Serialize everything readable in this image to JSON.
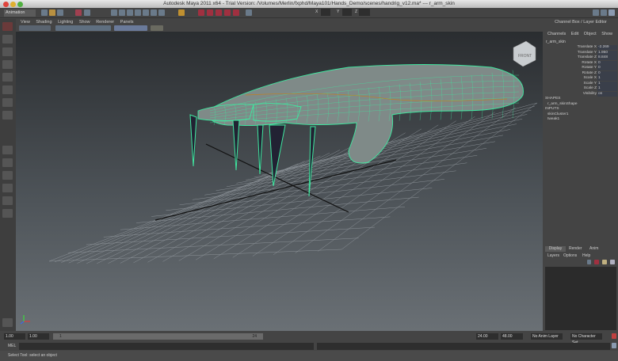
{
  "window": {
    "title": "Autodesk Maya 2011 x64 - Trial Version: /Volumes/Merlin/fxphd/Maya101/Hands_Demo/scenes/handrig_v12.ma*  ---  r_arm_skin"
  },
  "statusline": {
    "mode": "Animation",
    "coord_labels": [
      "X",
      "Y",
      "Z"
    ]
  },
  "viewport": {
    "menu": [
      "View",
      "Shading",
      "Lighting",
      "Show",
      "Renderer",
      "Panels"
    ],
    "viewcube": "FRONT"
  },
  "channel_box": {
    "title": "Channel Box / Layer Editor",
    "menu": [
      "Channels",
      "Edit",
      "Object",
      "Show"
    ],
    "object": "r_arm_skin",
    "attributes": [
      {
        "name": "Translate X",
        "value": "-2.269"
      },
      {
        "name": "Translate Y",
        "value": "1.950"
      },
      {
        "name": "Translate Z",
        "value": "8.848"
      },
      {
        "name": "Rotate X",
        "value": "0"
      },
      {
        "name": "Rotate Y",
        "value": "0"
      },
      {
        "name": "Rotate Z",
        "value": "0"
      },
      {
        "name": "Scale X",
        "value": "1"
      },
      {
        "name": "Scale Y",
        "value": "1"
      },
      {
        "name": "Scale Z",
        "value": "1"
      },
      {
        "name": "Visibility",
        "value": "on"
      }
    ],
    "shapes_header": "SHAPES",
    "shape": "r_arm_skinShape",
    "inputs_header": "INPUTS",
    "inputs": [
      "skinCluster1",
      "tweak1"
    ]
  },
  "layer_editor": {
    "tabs": [
      "Display",
      "Render",
      "Anim"
    ],
    "menu": [
      "Layers",
      "Options",
      "Help"
    ]
  },
  "timeline": {
    "start": "1.00",
    "range_start": "1.00",
    "current": "1",
    "range_end_marker": "24",
    "end": "24.00",
    "max": "48.00",
    "anim_layer": "No Anim Layer",
    "character_set": "No Character Set"
  },
  "command": {
    "label": "MEL"
  },
  "help": {
    "text": "Select Tool: select an object"
  },
  "colors": {
    "wire": "#3fe8a0",
    "grid": "#9aa0a6"
  }
}
